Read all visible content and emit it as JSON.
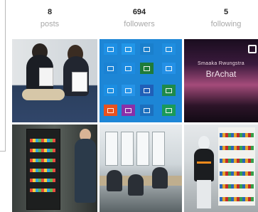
{
  "profile": {
    "stats": [
      {
        "value": "8",
        "label": "posts"
      },
      {
        "value": "694",
        "label": "followers"
      },
      {
        "value": "5",
        "label": "following"
      }
    ]
  },
  "grid": {
    "posts": [
      {
        "icon": "photo-two-students-with-papers"
      },
      {
        "icon": "photo-office-app-icons"
      },
      {
        "icon": "video-still",
        "caption_line1": "Smaaka Rwungstra",
        "caption_line2": "BrAchat"
      },
      {
        "icon": "photo-vending-machine"
      },
      {
        "icon": "photo-classroom"
      },
      {
        "icon": "photo-mannequin-shelves"
      }
    ]
  },
  "colors": {
    "stat_value": "#262626",
    "stat_label": "#a8a8a8",
    "apps_bg": "#1d86d6"
  }
}
